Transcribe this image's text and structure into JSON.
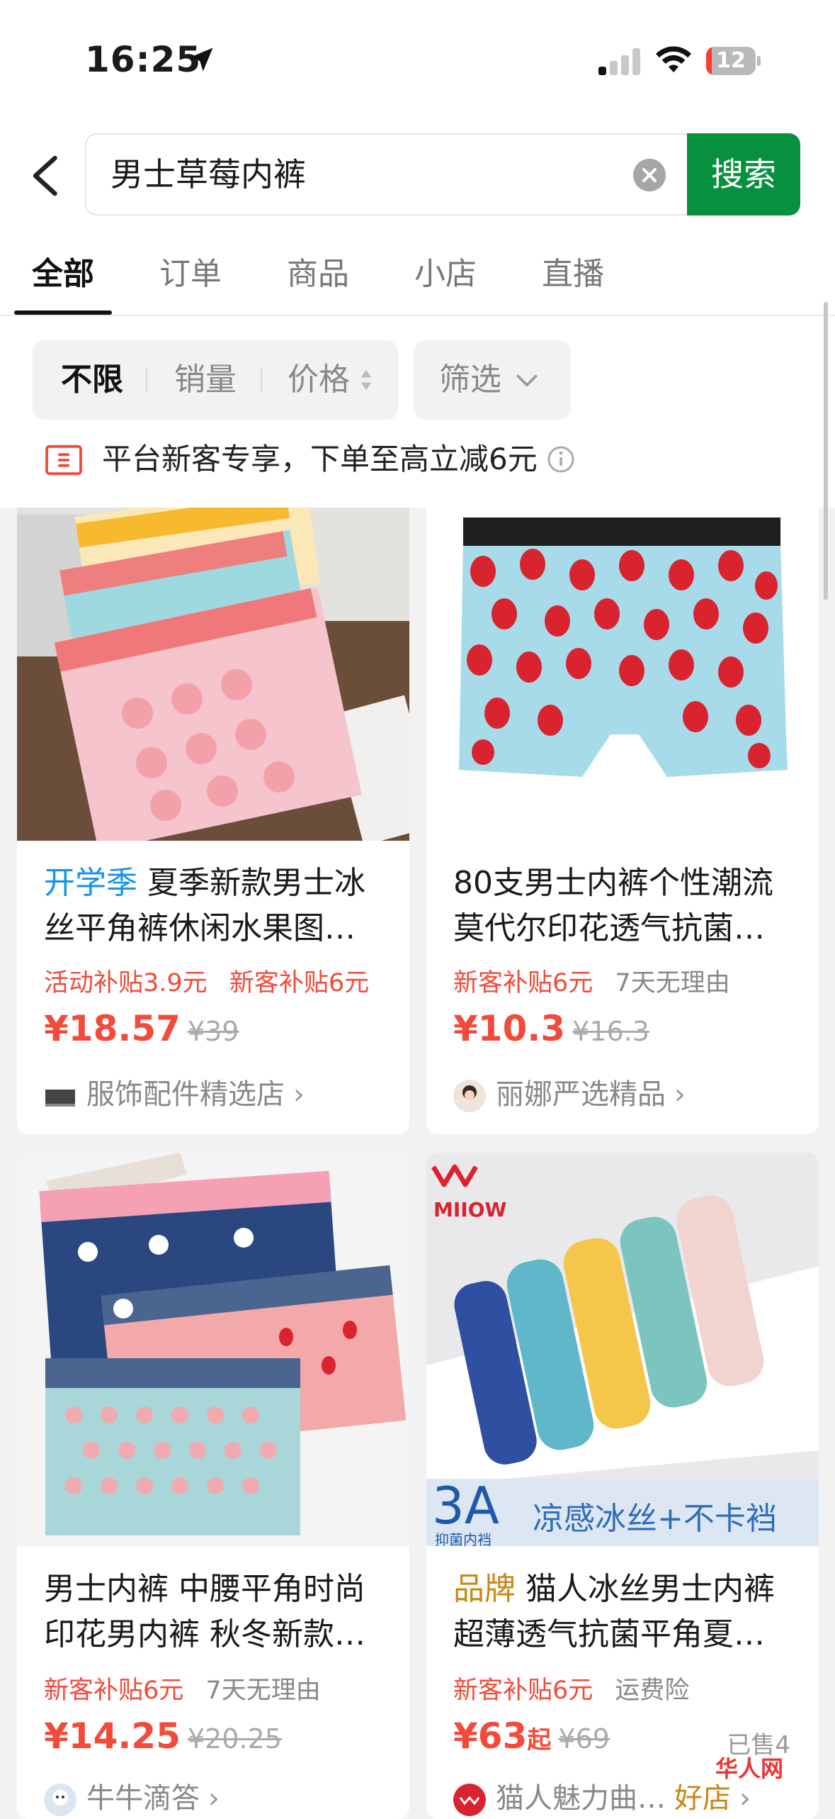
{
  "status": {
    "time": "16:25",
    "battery": "12",
    "battery_level": 0.12
  },
  "search": {
    "query": "男士草莓内裤",
    "button": "搜索"
  },
  "tabs": [
    {
      "label": "全部"
    },
    {
      "label": "订单"
    },
    {
      "label": "商品"
    },
    {
      "label": "小店"
    },
    {
      "label": "直播"
    }
  ],
  "filters": {
    "unlimited": "不限",
    "sales": "销量",
    "price": "价格",
    "screen": "筛选"
  },
  "promo": {
    "text": "平台新客专享，下单至高立减6元"
  },
  "products": [
    {
      "tag": "开学季",
      "title_line1": "夏季新款男士冰",
      "title_line2": "丝平角裤休闲水果图…",
      "subsidy1": "活动补贴3.9元",
      "subsidy2": "新客补贴6元",
      "price": "¥18.57",
      "orig_price": "¥39",
      "shop": "服饰配件精选店"
    },
    {
      "tag": "",
      "title_line1": "80支男士内裤个性潮流",
      "title_line2": "莫代尔印花透气抗菌…",
      "subsidy1": "新客补贴6元",
      "subsidy2": "7天无理由",
      "price": "¥10.3",
      "orig_price": "¥16.3",
      "shop": "丽娜严选精品"
    },
    {
      "tag": "",
      "title_line1": "男士内裤 中腰平角时尚",
      "title_line2": "印花男内裤 秋冬新款…",
      "subsidy1": "新客补贴6元",
      "subsidy2": "7天无理由",
      "price": "¥14.25",
      "orig_price": "¥20.25",
      "shop": "牛牛滴答"
    },
    {
      "tag": "品牌",
      "title_line1": "猫人冰丝男士内裤",
      "title_line2": "超薄透气抗菌平角夏…",
      "subsidy1": "新客补贴6元",
      "subsidy2": "运费险",
      "price": "¥63",
      "price_unit": "起",
      "orig_price": "¥69",
      "sold": "已售4",
      "shop": "猫人魅力曲…",
      "shop_badge": "好店"
    }
  ],
  "product_images": {
    "miiow_brand": "MIIOW",
    "miiow_grade": "3A",
    "miiow_grade_sub": "抑菌内裆",
    "miiow_slogan": "凉感冰丝+不卡裆"
  },
  "watermark": "华人网"
}
